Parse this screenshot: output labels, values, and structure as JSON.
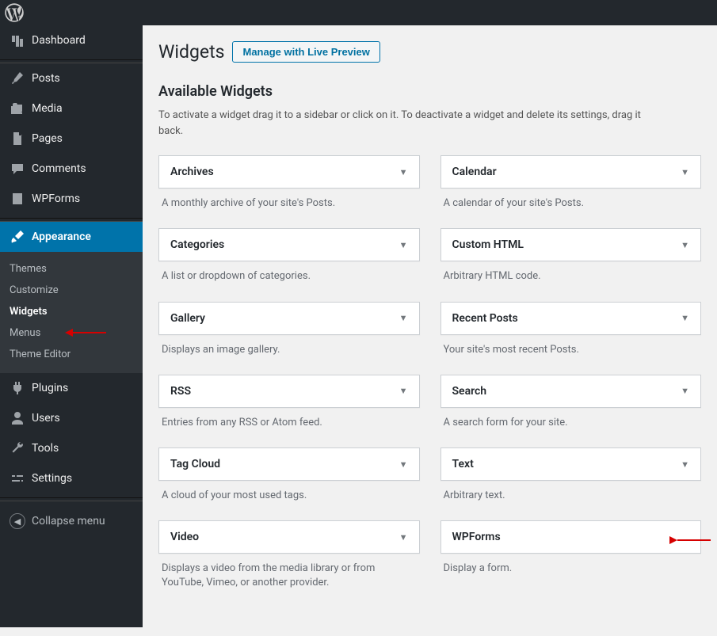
{
  "topbar": {
    "logo_name": "wordpress-logo"
  },
  "sidebar": {
    "items": [
      {
        "icon": "dashboard-icon",
        "label": "Dashboard"
      },
      {
        "icon": "pin-icon",
        "label": "Posts"
      },
      {
        "icon": "media-icon",
        "label": "Media"
      },
      {
        "icon": "page-icon",
        "label": "Pages"
      },
      {
        "icon": "comment-icon",
        "label": "Comments"
      },
      {
        "icon": "form-icon",
        "label": "WPForms"
      },
      {
        "icon": "brush-icon",
        "label": "Appearance"
      },
      {
        "icon": "plugin-icon",
        "label": "Plugins"
      },
      {
        "icon": "user-icon",
        "label": "Users"
      },
      {
        "icon": "wrench-icon",
        "label": "Tools"
      },
      {
        "icon": "settings-icon",
        "label": "Settings"
      }
    ],
    "submenu": [
      {
        "label": "Themes"
      },
      {
        "label": "Customize"
      },
      {
        "label": "Widgets"
      },
      {
        "label": "Menus"
      },
      {
        "label": "Theme Editor"
      }
    ],
    "collapse_label": "Collapse menu"
  },
  "page": {
    "title": "Widgets",
    "preview_button": "Manage with Live Preview",
    "section_title": "Available Widgets",
    "section_desc": "To activate a widget drag it to a sidebar or click on it. To deactivate a widget and delete its settings, drag it back."
  },
  "widgets": {
    "left": [
      {
        "title": "Archives",
        "desc": "A monthly archive of your site's Posts."
      },
      {
        "title": "Categories",
        "desc": "A list or dropdown of categories."
      },
      {
        "title": "Gallery",
        "desc": "Displays an image gallery."
      },
      {
        "title": "RSS",
        "desc": "Entries from any RSS or Atom feed."
      },
      {
        "title": "Tag Cloud",
        "desc": "A cloud of your most used tags."
      },
      {
        "title": "Video",
        "desc": "Displays a video from the media library or from YouTube, Vimeo, or another provider."
      }
    ],
    "right": [
      {
        "title": "Calendar",
        "desc": "A calendar of your site's Posts."
      },
      {
        "title": "Custom HTML",
        "desc": "Arbitrary HTML code."
      },
      {
        "title": "Recent Posts",
        "desc": "Your site's most recent Posts."
      },
      {
        "title": "Search",
        "desc": "A search form for your site."
      },
      {
        "title": "Text",
        "desc": "Arbitrary text."
      },
      {
        "title": "WPForms",
        "desc": "Display a form."
      }
    ]
  }
}
